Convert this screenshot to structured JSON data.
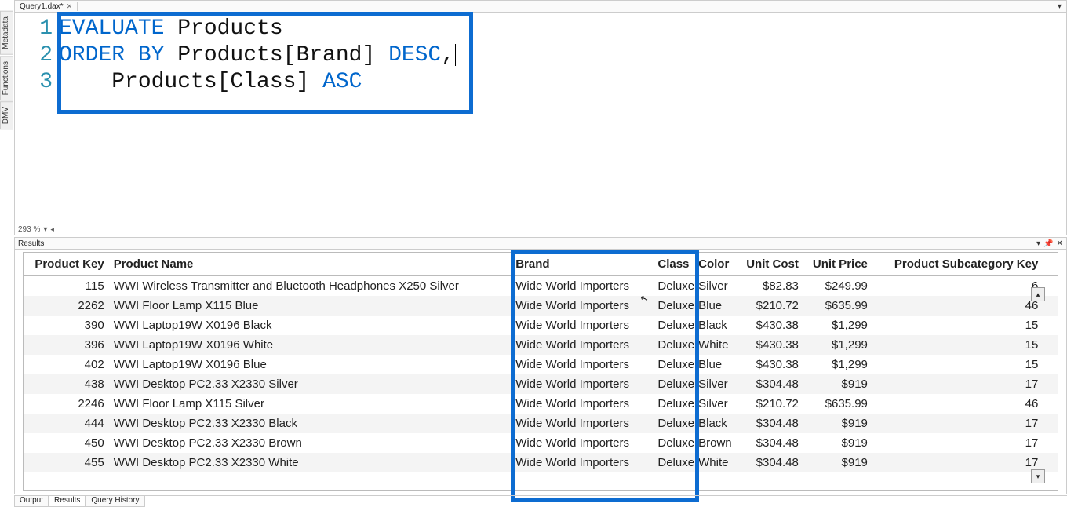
{
  "editor": {
    "tab_title": "Query1.dax*",
    "zoom": "293 %",
    "lines": [
      {
        "n": "1",
        "tokens": [
          {
            "t": "EVALUATE",
            "c": "kw"
          },
          {
            "t": " Products",
            "c": "plain"
          }
        ]
      },
      {
        "n": "2",
        "tokens": [
          {
            "t": "ORDER BY",
            "c": "kw"
          },
          {
            "t": " Products[Brand] ",
            "c": "plain"
          },
          {
            "t": "DESC",
            "c": "kw"
          },
          {
            "t": ",",
            "c": "plain"
          }
        ]
      },
      {
        "n": "3",
        "tokens": [
          {
            "t": "    Products[Class] ",
            "c": "plain"
          },
          {
            "t": "ASC",
            "c": "kw"
          }
        ]
      }
    ]
  },
  "side_tabs": [
    "Metadata",
    "Functions",
    "DMV"
  ],
  "results": {
    "title": "Results",
    "columns": [
      {
        "label": "Product Key",
        "align": "num"
      },
      {
        "label": "Product Name",
        "align": "left"
      },
      {
        "label": "Brand",
        "align": "left"
      },
      {
        "label": "Class",
        "align": "left"
      },
      {
        "label": "Color",
        "align": "left"
      },
      {
        "label": "Unit Cost",
        "align": "num"
      },
      {
        "label": "Unit Price",
        "align": "num"
      },
      {
        "label": "Product Subcategory Key",
        "align": "num"
      }
    ],
    "rows": [
      {
        "key": "115",
        "name": "WWI Wireless Transmitter and Bluetooth Headphones X250 Silver",
        "brand": "Wide World Importers",
        "class": "Deluxe",
        "color": "Silver",
        "cost": "$82.83",
        "price": "$249.99",
        "sub": "6"
      },
      {
        "key": "2262",
        "name": "WWI Floor Lamp X115 Blue",
        "brand": "Wide World Importers",
        "class": "Deluxe",
        "color": "Blue",
        "cost": "$210.72",
        "price": "$635.99",
        "sub": "46"
      },
      {
        "key": "390",
        "name": "WWI Laptop19W X0196 Black",
        "brand": "Wide World Importers",
        "class": "Deluxe",
        "color": "Black",
        "cost": "$430.38",
        "price": "$1,299",
        "sub": "15"
      },
      {
        "key": "396",
        "name": "WWI Laptop19W X0196 White",
        "brand": "Wide World Importers",
        "class": "Deluxe",
        "color": "White",
        "cost": "$430.38",
        "price": "$1,299",
        "sub": "15"
      },
      {
        "key": "402",
        "name": "WWI Laptop19W X0196 Blue",
        "brand": "Wide World Importers",
        "class": "Deluxe",
        "color": "Blue",
        "cost": "$430.38",
        "price": "$1,299",
        "sub": "15"
      },
      {
        "key": "438",
        "name": "WWI Desktop PC2.33 X2330 Silver",
        "brand": "Wide World Importers",
        "class": "Deluxe",
        "color": "Silver",
        "cost": "$304.48",
        "price": "$919",
        "sub": "17"
      },
      {
        "key": "2246",
        "name": "WWI Floor Lamp X115 Silver",
        "brand": "Wide World Importers",
        "class": "Deluxe",
        "color": "Silver",
        "cost": "$210.72",
        "price": "$635.99",
        "sub": "46"
      },
      {
        "key": "444",
        "name": "WWI Desktop PC2.33 X2330 Black",
        "brand": "Wide World Importers",
        "class": "Deluxe",
        "color": "Black",
        "cost": "$304.48",
        "price": "$919",
        "sub": "17"
      },
      {
        "key": "450",
        "name": "WWI Desktop PC2.33 X2330 Brown",
        "brand": "Wide World Importers",
        "class": "Deluxe",
        "color": "Brown",
        "cost": "$304.48",
        "price": "$919",
        "sub": "17"
      },
      {
        "key": "455",
        "name": "WWI Desktop PC2.33 X2330 White",
        "brand": "Wide World Importers",
        "class": "Deluxe",
        "color": "White",
        "cost": "$304.48",
        "price": "$919",
        "sub": "17"
      }
    ]
  },
  "bottom_tabs": [
    "Output",
    "Results",
    "Query History"
  ],
  "highlight_color": "#0d6cd1"
}
